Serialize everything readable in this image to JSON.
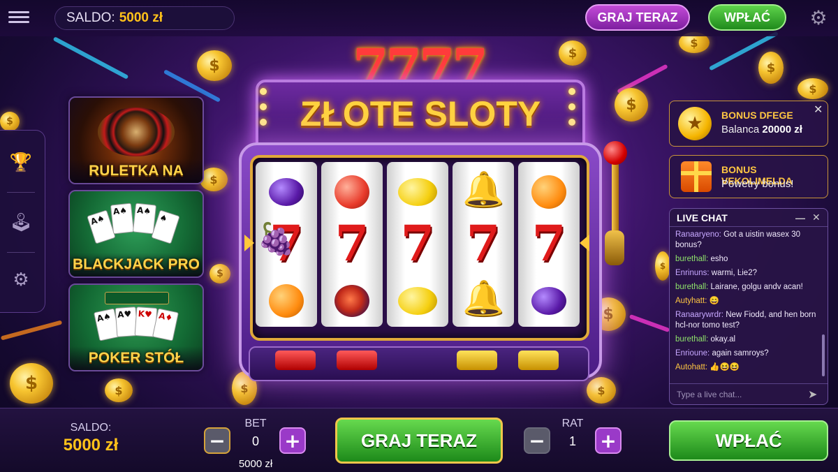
{
  "topbar": {
    "saldo_label": "SALDO:",
    "saldo_value": "5000 zł",
    "play_label": "GRAJ TERAZ",
    "deposit_label": "WPŁAĆ",
    "menu_icon": "hamburger-icon",
    "settings_icon": "gear-icon"
  },
  "rail": {
    "items": [
      {
        "icon": "trophy-icon"
      },
      {
        "icon": "joystick-icon"
      },
      {
        "icon": "gear-icon"
      }
    ]
  },
  "games": [
    {
      "label": "RULETKA NA ŻYWO",
      "icon": "roulette-icon"
    },
    {
      "label": "BLACKJACK PRO",
      "icon": "cards-icon"
    },
    {
      "label": "POKER STÓŁ",
      "icon": "poker-table-icon"
    }
  ],
  "machine": {
    "marquee_digits": "7777",
    "title": "ZŁOTE SLOTY",
    "reels": [
      [
        "plum",
        "seven",
        "orange"
      ],
      [
        "peach",
        "seven",
        "fig"
      ],
      [
        "lemon",
        "seven",
        "lemon"
      ],
      [
        "bell",
        "seven",
        "bell"
      ],
      [
        "orange",
        "seven",
        "plum"
      ]
    ],
    "left_extra_symbol": "grapes"
  },
  "bonuses": [
    {
      "title": "BONUS DFEGE",
      "sub_prefix": "Balanca ",
      "sub_value": "20000 zł",
      "icon": "star-coin-icon"
    },
    {
      "title": "BONUS VEKOLIMELDA",
      "sub_prefix": "Powetry bonus!",
      "sub_value": "",
      "icon": "gift-icon"
    }
  ],
  "chat": {
    "title": "LIVE CHAT",
    "messages": [
      {
        "user": "Ranaaryeno:",
        "text": "Got a uistin wasex 30 bonus?",
        "color": "#c7a8ff"
      },
      {
        "user": "burethall:",
        "text": "esho",
        "color": "#8ee36a"
      },
      {
        "user": "Enrinuns:",
        "text": "warmi, Ŀie2?",
        "color": "#c7a8ff"
      },
      {
        "user": "burethall:",
        "text": "Lairane, golgu andv acan!",
        "color": "#8ee36a"
      },
      {
        "user": "Autyhatt:",
        "text": "😄",
        "color": "#ffc642"
      },
      {
        "user": "Ranaarywrdr:",
        "text": "New Fiodd, and hen born hcl-nor tomo test?",
        "color": "#c7a8ff"
      },
      {
        "user": "burethall:",
        "text": "okay.al",
        "color": "#8ee36a"
      },
      {
        "user": "Enrioune:",
        "text": "again samroys?",
        "color": "#c7a8ff"
      },
      {
        "user": "Autohatt:",
        "text": "👍😆😆",
        "color": "#ffc642"
      }
    ],
    "input_placeholder": "Type a live chat..."
  },
  "bottombar": {
    "saldo_label": "SALDO:",
    "saldo_value": "5000 zł",
    "bet_label": "BET",
    "bet_value": "0",
    "bet_sub": "5000 zł",
    "rat_label": "RAT",
    "rat_value": "1",
    "play_label": "GRAJ TERAZ",
    "deposit_label": "WPŁAĆ"
  },
  "colors": {
    "gold": "#ffc21a",
    "purple_accent": "#9a3ac8",
    "green_button": "#2fa82a"
  }
}
